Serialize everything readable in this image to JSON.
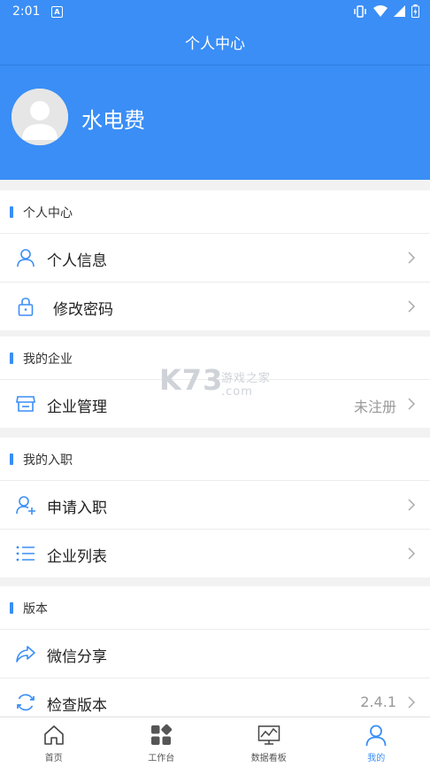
{
  "status_bar": {
    "time": "2:01",
    "notification_glyph": "A"
  },
  "header": {
    "title": "个人中心"
  },
  "profile": {
    "name": "水电费"
  },
  "sections": [
    {
      "title": "个人中心",
      "items": [
        {
          "label": "个人信息",
          "value": ""
        },
        {
          "label": "修改密码",
          "value": ""
        }
      ]
    },
    {
      "title": "我的企业",
      "items": [
        {
          "label": "企业管理",
          "value": "未注册"
        }
      ]
    },
    {
      "title": "我的入职",
      "items": [
        {
          "label": "申请入职",
          "value": ""
        },
        {
          "label": "企业列表",
          "value": ""
        }
      ]
    },
    {
      "title": "版本",
      "items": [
        {
          "label": "微信分享",
          "value": ""
        },
        {
          "label": "检查版本",
          "value": "2.4.1"
        }
      ]
    }
  ],
  "watermark": {
    "logo": "K73",
    "text": "游戏之家",
    "domain": ".com"
  },
  "tabbar": [
    {
      "label": "首页",
      "icon": "home-icon",
      "active": false
    },
    {
      "label": "工作台",
      "icon": "grid-icon",
      "active": false
    },
    {
      "label": "数据看板",
      "icon": "chart-icon",
      "active": false
    },
    {
      "label": "我的",
      "icon": "user-icon",
      "active": true
    }
  ],
  "colors": {
    "primary": "#3a8ef6",
    "background": "#f2f2f2",
    "muted": "#999999"
  }
}
